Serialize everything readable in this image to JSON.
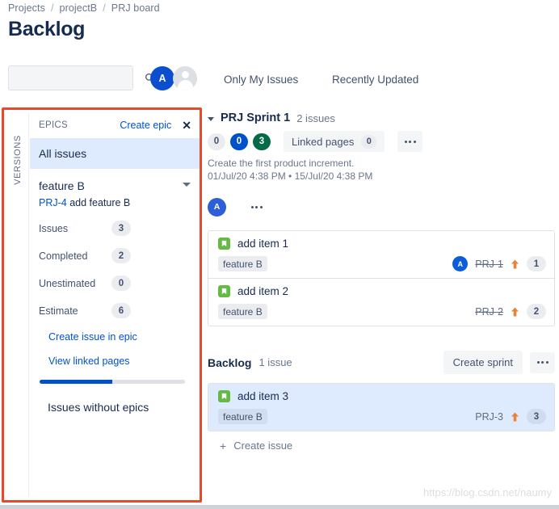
{
  "breadcrumb": {
    "items": [
      "Projects",
      "projectB",
      "PRJ board"
    ],
    "separator": "/"
  },
  "page_title": "Backlog",
  "toolbar": {
    "search_placeholder": "",
    "search_value": "",
    "search_icon": "search-icon",
    "avatar_initial": "A",
    "filters": [
      {
        "label": "Only My Issues"
      },
      {
        "label": "Recently Updated"
      }
    ]
  },
  "versions_rail": {
    "label": "VERSIONS"
  },
  "epics_panel": {
    "header_title": "EPICS",
    "create_label": "Create epic",
    "close_icon": "close-icon",
    "all_issues_label": "All issues",
    "epic": {
      "name": "feature B",
      "key": "PRJ-4",
      "summary": "add feature B",
      "stats": [
        {
          "label": "Issues",
          "value": "3"
        },
        {
          "label": "Completed",
          "value": "2"
        },
        {
          "label": "Unestimated",
          "value": "0"
        },
        {
          "label": "Estimate",
          "value": "6"
        }
      ],
      "create_issue_link": "Create issue in epic",
      "view_pages_link": "View linked pages",
      "progress_percent": 50
    },
    "no_epics_label": "Issues without epics"
  },
  "sprint": {
    "name": "PRJ Sprint 1",
    "issue_count": "2 issues",
    "badges": [
      {
        "value": "0",
        "color": "#ebecf0"
      },
      {
        "value": "0",
        "color": "#0052cc"
      },
      {
        "value": "3",
        "color": "#036b45"
      }
    ],
    "linked_pages_label": "Linked pages",
    "linked_pages_count": "0",
    "goal": "Create the first product increment.",
    "dates": "01/Jul/20 4:38 PM • 15/Jul/20 4:38 PM",
    "assignee_initial": "A",
    "issues": [
      {
        "summary": "add item 1",
        "epic_tag": "feature B",
        "assignee_initial": "A",
        "has_assignee": true,
        "key": "PRJ-1",
        "done": true,
        "priority_icon": "priority-high-arrow-icon",
        "estimate": "1",
        "selected": false
      },
      {
        "summary": "add item 2",
        "epic_tag": "feature B",
        "assignee_initial": "",
        "has_assignee": false,
        "key": "PRJ-2",
        "done": true,
        "priority_icon": "priority-high-arrow-icon",
        "estimate": "2",
        "selected": false
      }
    ]
  },
  "backlog": {
    "title": "Backlog",
    "issue_count": "1 issue",
    "create_sprint_label": "Create sprint",
    "create_issue_label": "Create issue",
    "issues": [
      {
        "summary": "add item 3",
        "epic_tag": "feature B",
        "assignee_initial": "",
        "has_assignee": false,
        "key": "PRJ-3",
        "done": false,
        "priority_icon": "priority-high-arrow-icon",
        "estimate": "3",
        "selected": true
      }
    ]
  },
  "watermark": "https://blog.csdn.net/naumy",
  "colors": {
    "accent_blue": "#0052cc",
    "annotation_red": "#e8492b",
    "story_green": "#65ba43",
    "priority_orange": "#e9833a",
    "selected_blue": "#deebff"
  }
}
